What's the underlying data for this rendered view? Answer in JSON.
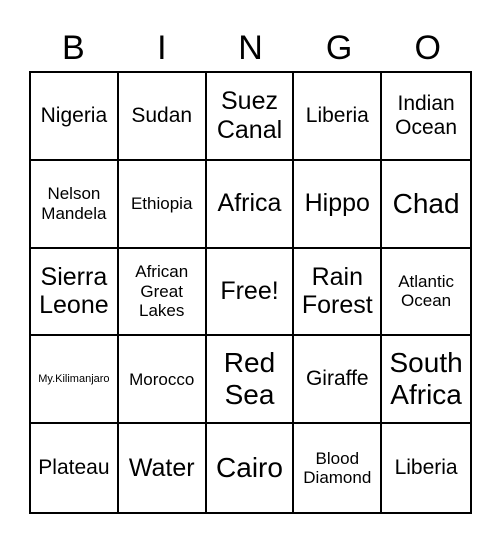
{
  "header": [
    "B",
    "I",
    "N",
    "G",
    "O"
  ],
  "rows": [
    [
      {
        "text": "Nigeria",
        "size": "m"
      },
      {
        "text": "Sudan",
        "size": "m"
      },
      {
        "text": "Suez Canal",
        "size": "l"
      },
      {
        "text": "Liberia",
        "size": "m"
      },
      {
        "text": "Indian Ocean",
        "size": "m"
      }
    ],
    [
      {
        "text": "Nelson Mandela",
        "size": "s"
      },
      {
        "text": "Ethiopia",
        "size": "s"
      },
      {
        "text": "Africa",
        "size": "l"
      },
      {
        "text": "Hippo",
        "size": "l"
      },
      {
        "text": "Chad",
        "size": "xl"
      }
    ],
    [
      {
        "text": "Sierra Leone",
        "size": "l"
      },
      {
        "text": "African Great Lakes",
        "size": "s"
      },
      {
        "text": "Free!",
        "size": "l"
      },
      {
        "text": "Rain Forest",
        "size": "l"
      },
      {
        "text": "Atlantic Ocean",
        "size": "s"
      }
    ],
    [
      {
        "text": "My.Kilimanjaro",
        "size": "xs"
      },
      {
        "text": "Morocco",
        "size": "s"
      },
      {
        "text": "Red Sea",
        "size": "xl"
      },
      {
        "text": "Giraffe",
        "size": "m"
      },
      {
        "text": "South Africa",
        "size": "xl"
      }
    ],
    [
      {
        "text": "Plateau",
        "size": "m"
      },
      {
        "text": "Water",
        "size": "l"
      },
      {
        "text": "Cairo",
        "size": "xl"
      },
      {
        "text": "Blood Diamond",
        "size": "s"
      },
      {
        "text": "Liberia",
        "size": "m"
      }
    ]
  ]
}
